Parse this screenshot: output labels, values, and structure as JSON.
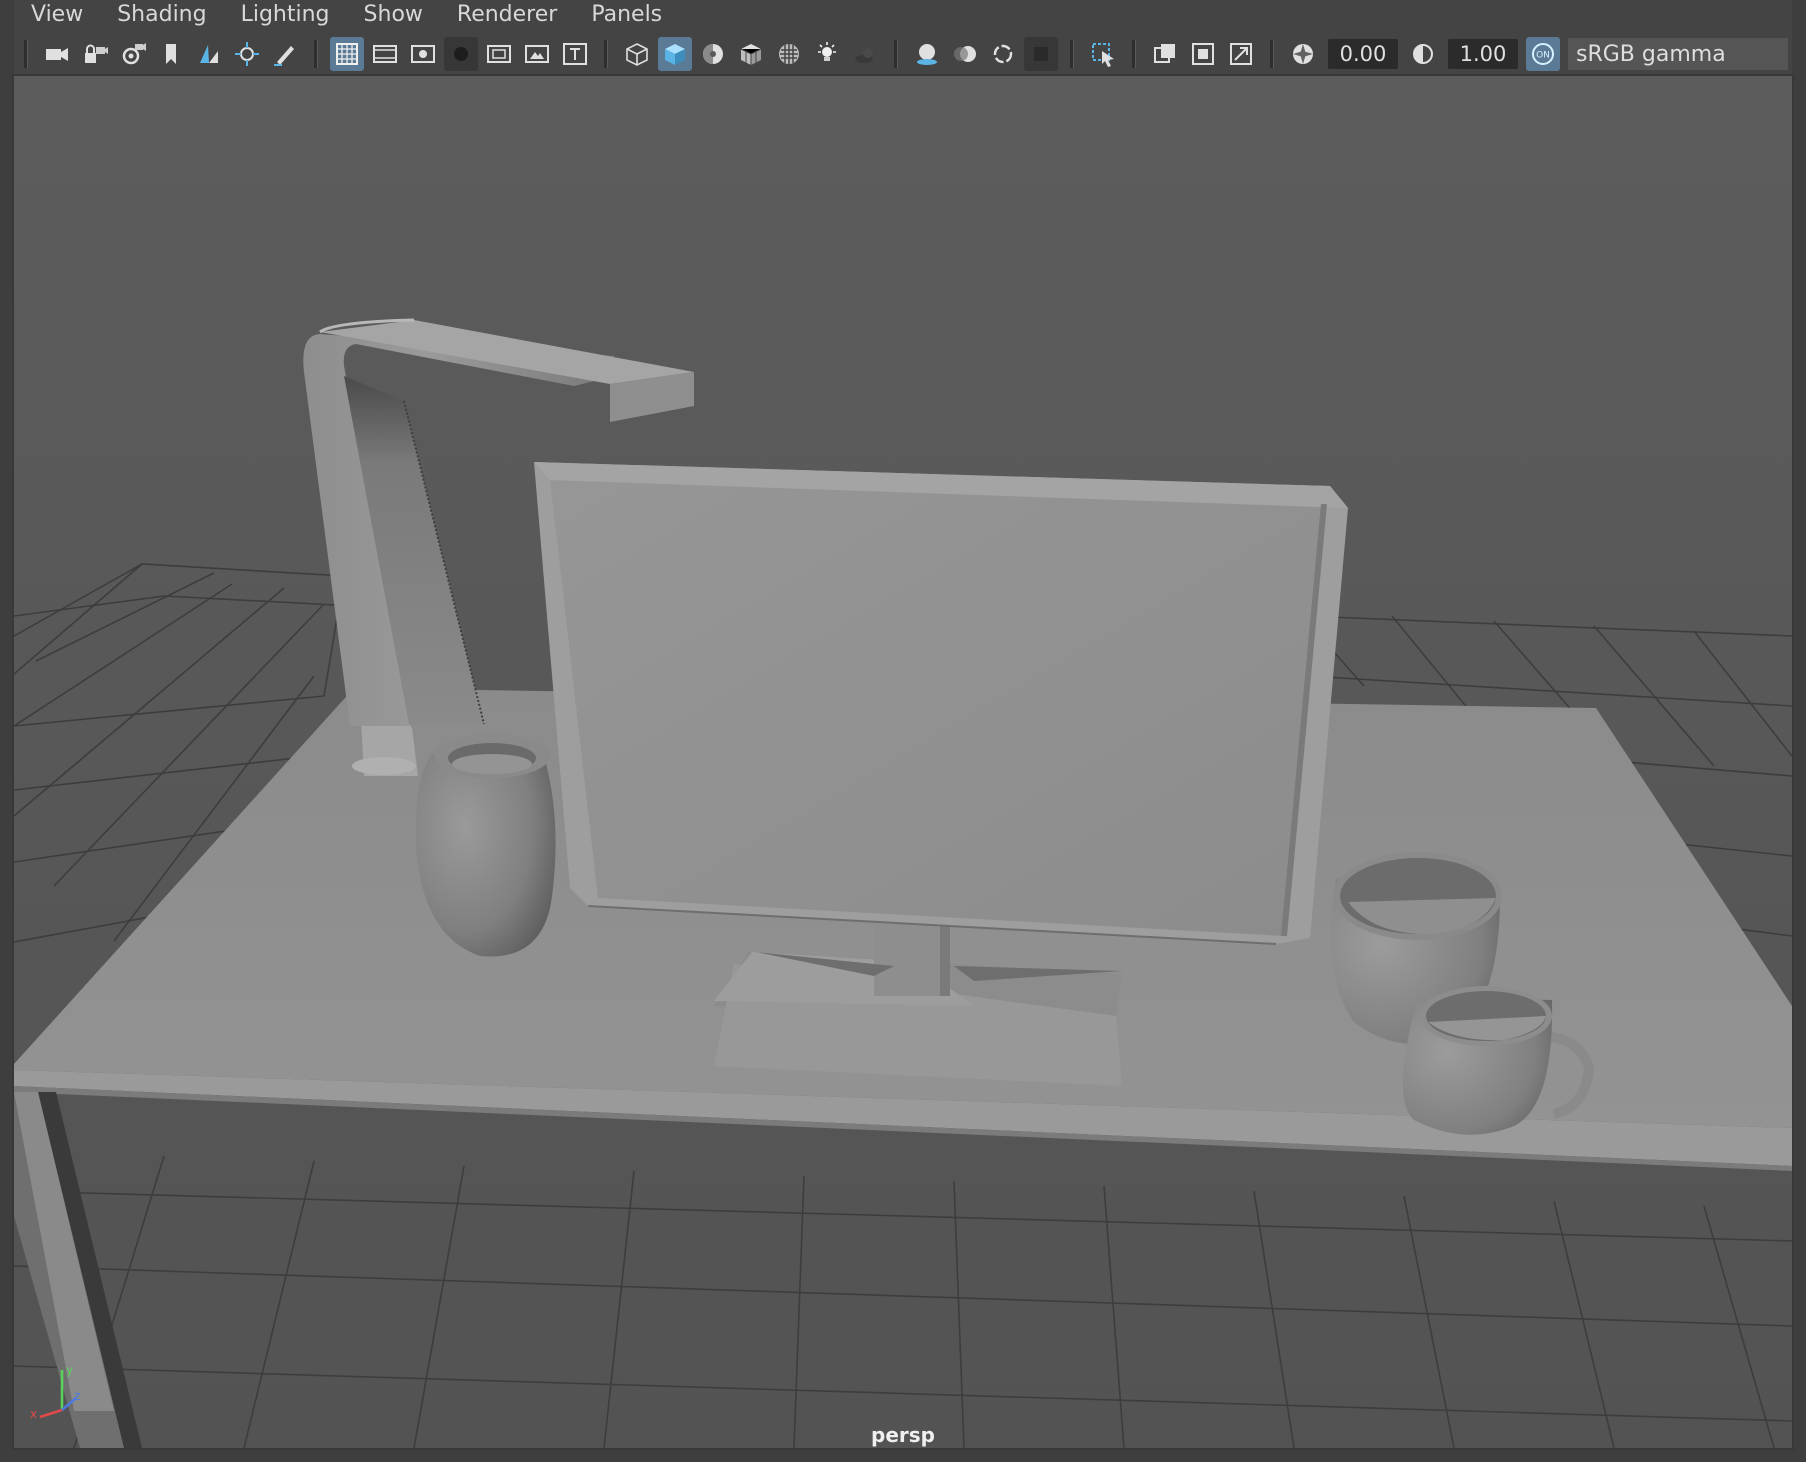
{
  "menubar": {
    "items": [
      {
        "label": "View"
      },
      {
        "label": "Shading"
      },
      {
        "label": "Lighting"
      },
      {
        "label": "Show"
      },
      {
        "label": "Renderer"
      },
      {
        "label": "Panels"
      }
    ]
  },
  "toolbar": {
    "exposure_value": "0.00",
    "gamma_value": "1.00",
    "color_management_toggle": "ON",
    "view_transform": "sRGB gamma",
    "active_tools": [
      "wireframe-on-shaded-grid",
      "smooth-shade-all"
    ],
    "icons": [
      "camera-select-icon",
      "camera-lock-icon",
      "camera-attributes-icon",
      "bookmark-icon",
      "image-plane-icon",
      "2d-pan-zoom-icon",
      "grease-pencil-icon",
      "grid-icon",
      "film-gate-icon",
      "resolution-gate-icon",
      "gate-mask-icon",
      "field-chart-icon",
      "safe-action-icon",
      "safe-title-icon",
      "wireframe-icon",
      "smooth-shade-icon",
      "shade-default-material-icon",
      "wireframe-on-shaded-icon",
      "xray-icon",
      "all-lights-icon",
      "shadows-icon",
      "screen-space-ao-icon",
      "motion-blur-icon",
      "multisample-aa-icon",
      "depth-of-field-icon",
      "isolate-select-icon",
      "xray-joints-icon",
      "xray-active-icon",
      "backface-icon",
      "exposure-icon",
      "gamma-icon",
      "color-management-icon"
    ]
  },
  "viewport": {
    "camera": "persp",
    "background_top": "#5b5b5b",
    "background_bottom": "#545454",
    "objects": [
      "desk",
      "desk-lamp",
      "monitor",
      "vase",
      "bowl",
      "mug"
    ]
  },
  "colors": {
    "accent": "#5ab4e6",
    "active_button": "#5a7a96",
    "grid_line": "#3c3c3c"
  }
}
